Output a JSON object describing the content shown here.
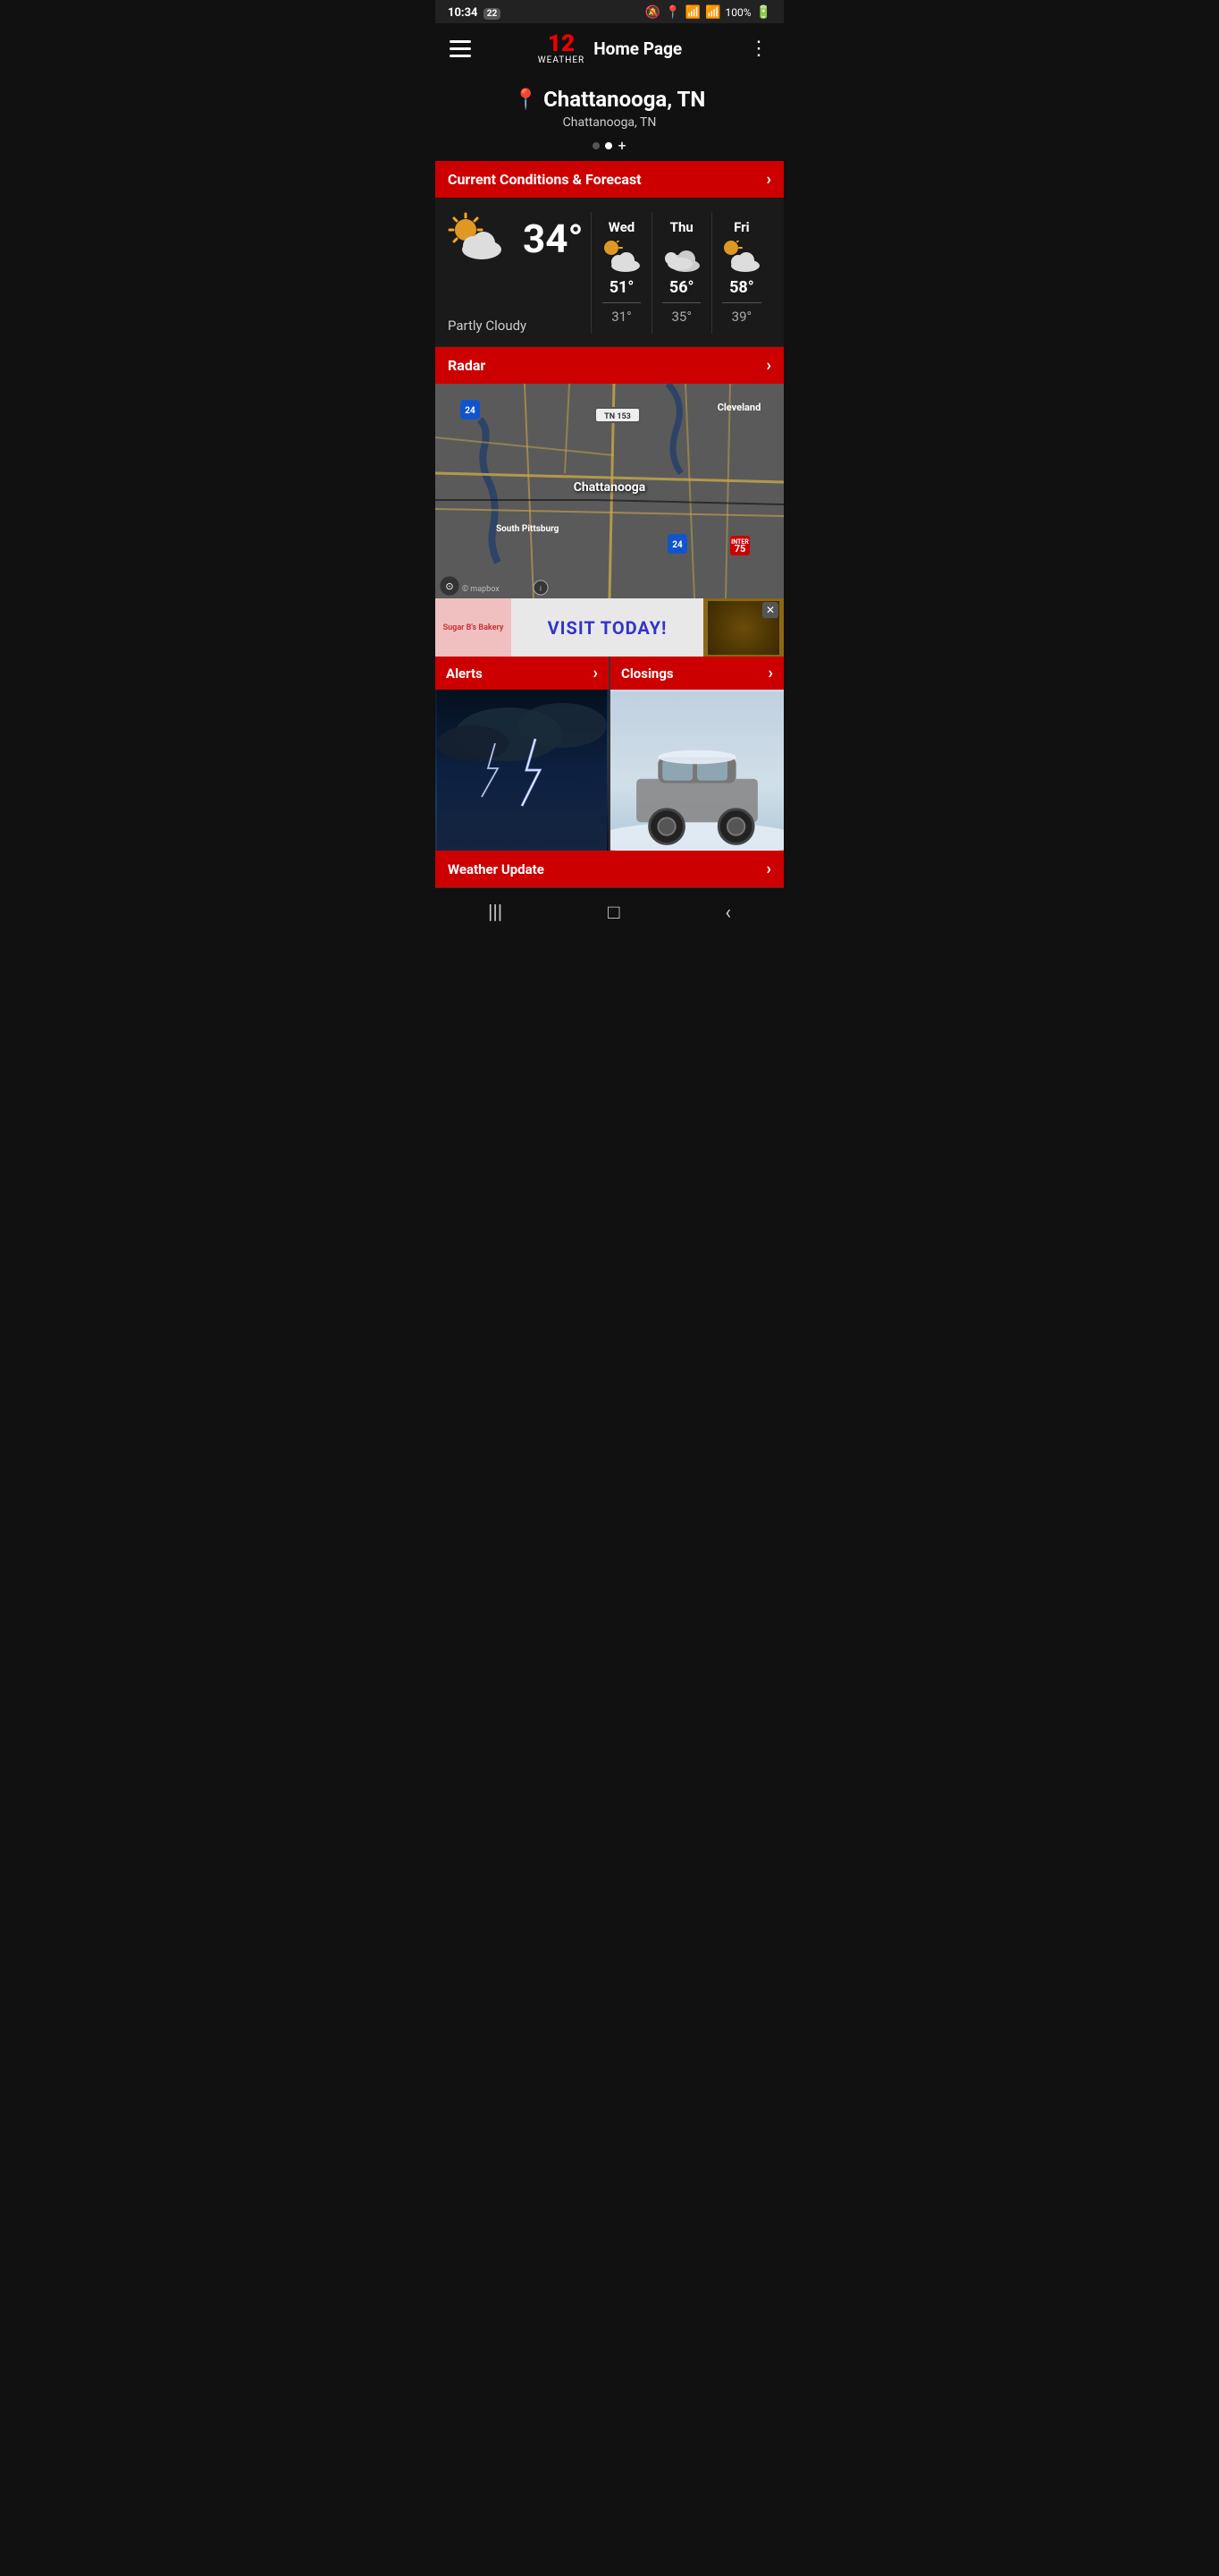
{
  "status": {
    "time": "10:34",
    "notification_badge": "22",
    "battery": "100%"
  },
  "nav": {
    "title": "Home Page",
    "logo_num": "12",
    "logo_sub": "WEATHER"
  },
  "location": {
    "main": "Chattanooga, TN",
    "sub": "Chattanooga, TN",
    "pin_icon": "📍"
  },
  "sections": {
    "forecast_label": "Current Conditions & Forecast",
    "radar_label": "Radar",
    "alerts_label": "Alerts",
    "closings_label": "Closings",
    "weather_update_label": "Weather Update"
  },
  "current_weather": {
    "temp": "34°",
    "condition": "Partly Cloudy"
  },
  "forecast": [
    {
      "day": "Wed",
      "high": "51°",
      "low": "31°"
    },
    {
      "day": "Thu",
      "high": "56°",
      "low": "35°"
    },
    {
      "day": "Fri",
      "high": "58°",
      "low": "39°"
    }
  ],
  "map": {
    "labels": {
      "chattanooga": "Chattanooga",
      "cleveland": "Cleveland",
      "south_pittsburg": "South Pittsburg",
      "tn153": "TN 153"
    },
    "highways": [
      "24",
      "75",
      "24"
    ]
  },
  "ad": {
    "left_text": "Sugar B's Bakery",
    "middle_text": "VISIT TODAY!",
    "close": "✕"
  },
  "bottom_nav": {
    "back": "‹",
    "home": "□",
    "menu": "|||"
  }
}
